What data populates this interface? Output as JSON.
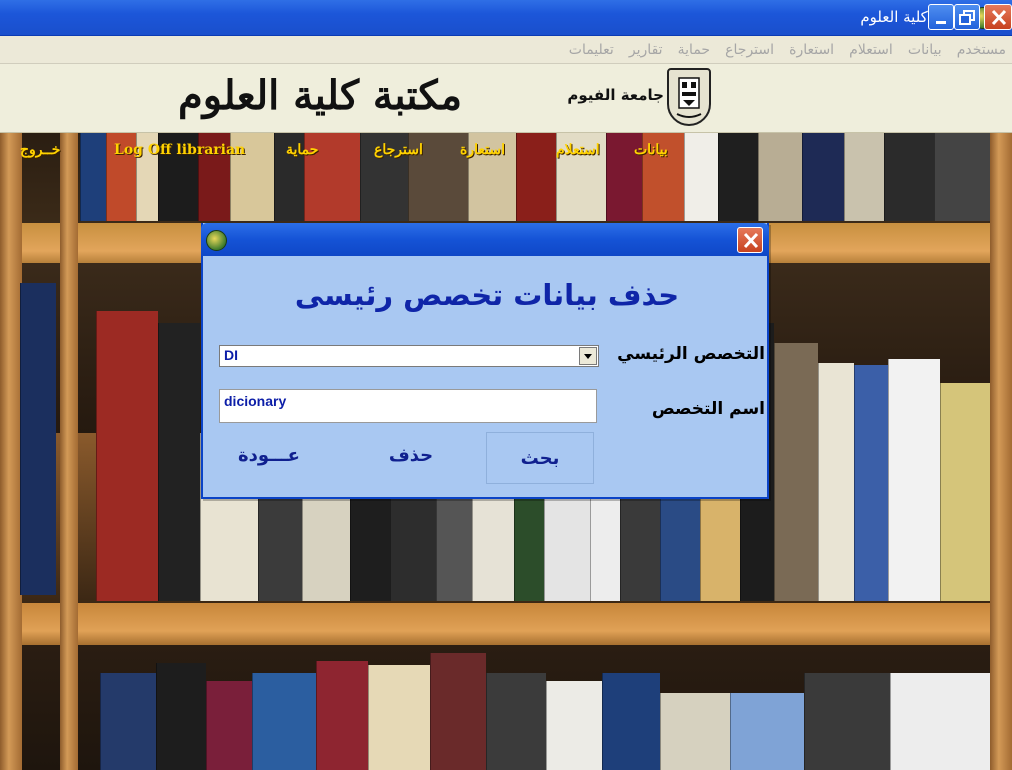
{
  "window": {
    "title": "مكتبة كلية العلوم"
  },
  "menu": {
    "items": [
      "مستخدم",
      "بيانات",
      "استعلام",
      "استعارة",
      "استرجاع",
      "حماية",
      "تقارير",
      "تعليمات"
    ]
  },
  "header": {
    "university": "جامعة الفيوم",
    "library": "مكتبة كلية العلوم"
  },
  "nav": {
    "data": "بيانات",
    "query": "استعلام",
    "borrow": "استعارة",
    "return": "استرجاع",
    "protection": "حماية",
    "logoff": "Log Off librarian",
    "exit": "خــروج"
  },
  "dialog": {
    "heading": "حذف بيانات تخصص رئيسى",
    "main_specialty_label": "التخصص الرئيسي",
    "main_specialty_value": "DI",
    "specialty_name_label": "اسم التخصص",
    "specialty_name_value": "dicionary",
    "search_label": "بحث",
    "delete_label": "حذف",
    "back_label": "عـــودة"
  },
  "colors": {
    "nav_link": "#ffd200",
    "dialog_bg": "#a9c8f2",
    "heading": "#0f25a8",
    "titlebar": "#1c56d9"
  }
}
